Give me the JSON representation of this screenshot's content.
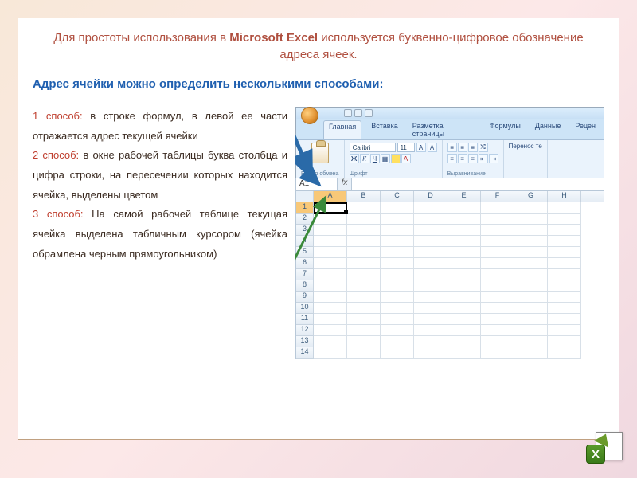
{
  "title": {
    "pre": "Для простоты использования в ",
    "app": "Microsoft Excel",
    "post": "  используется  буквенно-цифровое обозначение адреса  ячеек."
  },
  "subtitle": "Адрес ячейки можно определить несколькими способами:",
  "methods": [
    {
      "label": "1 способ:",
      "text": " в строке формул, в левой ее части отражается адрес текущей ячейки"
    },
    {
      "label": "2 способ:",
      "text": "  в окне рабочей таблицы буква столбца и цифра строки, на пересечении которых находится ячейка,  выделены цветом"
    },
    {
      "label": "3 способ:",
      "text": " На самой рабочей таблице текущая ячейка выделена табличным курсором (ячейка обрамлена черным прямоугольником)"
    }
  ],
  "excel": {
    "tabs": [
      "Главная",
      "Вставка",
      "Разметка страницы",
      "Формулы",
      "Данные",
      "Рецен"
    ],
    "active_tab": 0,
    "groups": {
      "clipboard": "Буфер обмена",
      "font": "Шрифт",
      "alignment": "Выравнивание"
    },
    "font_name": "Calibri",
    "font_size": "11",
    "wrap_text": "Перенос те",
    "name_box": "A1",
    "fx": "fx",
    "columns": [
      "A",
      "B",
      "C",
      "D",
      "E",
      "F",
      "G",
      "H"
    ],
    "rows": [
      "1",
      "2",
      "3",
      "4",
      "5",
      "6",
      "7",
      "8",
      "9",
      "10",
      "11",
      "12",
      "13",
      "14"
    ],
    "selected_col": "A",
    "selected_row": "1"
  },
  "logo": {
    "letter": "X"
  }
}
